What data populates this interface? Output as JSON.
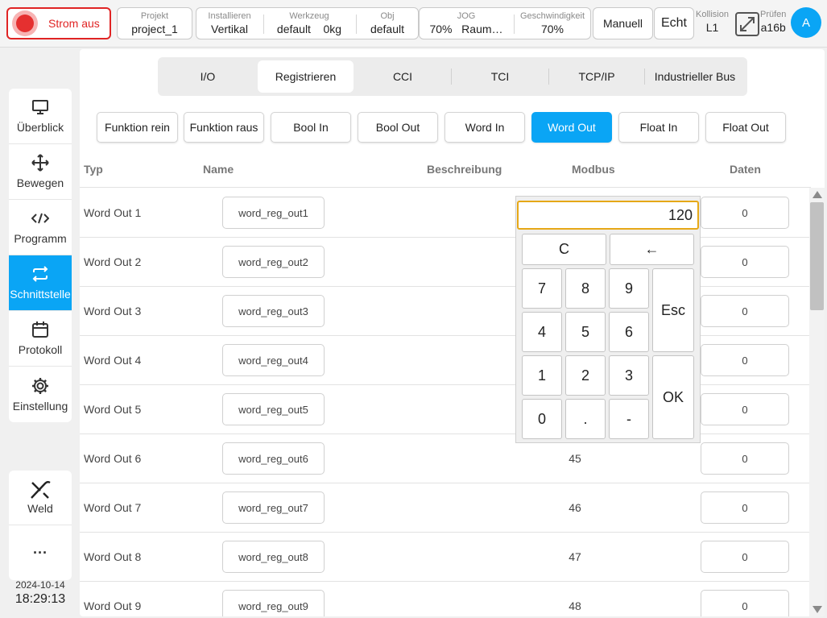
{
  "topbar": {
    "power_label": "Strom aus",
    "project": {
      "caption": "Projekt",
      "value": "project_1"
    },
    "install": {
      "caption": "Installieren",
      "value": "Vertikal"
    },
    "tool": {
      "caption": "Werkzeug",
      "name": "default",
      "weight": "0kg"
    },
    "obj": {
      "caption": "Obj",
      "value": "default"
    },
    "jog": {
      "caption": "JOG",
      "value": "70%",
      "frame": "Raum…"
    },
    "speed": {
      "caption": "Geschwindigkeit",
      "value": "70%"
    },
    "mode_label": "Manuell",
    "real_label": "Echt",
    "collision": {
      "caption": "Kollision",
      "value": "L1"
    },
    "check": {
      "caption": "Prüfen",
      "value": "a16b"
    },
    "avatar_letter": "A"
  },
  "sidebar": {
    "items": [
      {
        "label": "Überblick",
        "icon": "monitor-icon"
      },
      {
        "label": "Bewegen",
        "icon": "move-arrows-icon"
      },
      {
        "label": "Programm",
        "icon": "code-icon"
      },
      {
        "label": "Schnittstelle",
        "icon": "swap-arrows-icon",
        "active": true
      },
      {
        "label": "Protokoll",
        "icon": "calendar-icon"
      },
      {
        "label": "Einstellung",
        "icon": "gear-icon"
      }
    ],
    "weld_label": "Weld",
    "more_label": "···",
    "date": "2024-10-14",
    "time": "18:29:13"
  },
  "tabs": [
    "I/O",
    "Registrieren",
    "CCI",
    "TCI",
    "TCP/IP",
    "Industrieller Bus"
  ],
  "active_tab": "Registrieren",
  "subtabs": [
    "Funktion rein",
    "Funktion raus",
    "Bool In",
    "Bool Out",
    "Word In",
    "Word Out",
    "Float In",
    "Float Out"
  ],
  "active_subtab": "Word Out",
  "table": {
    "headers": {
      "typ": "Typ",
      "name": "Name",
      "desc": "Beschreibung",
      "modbus": "Modbus",
      "daten": "Daten"
    },
    "rows": [
      {
        "typ": "Word Out 1",
        "name": "word_reg_out1",
        "modbus": "",
        "daten": "0"
      },
      {
        "typ": "Word Out 2",
        "name": "word_reg_out2",
        "modbus": "",
        "daten": "0"
      },
      {
        "typ": "Word Out 3",
        "name": "word_reg_out3",
        "modbus": "",
        "daten": "0"
      },
      {
        "typ": "Word Out 4",
        "name": "word_reg_out4",
        "modbus": "",
        "daten": "0"
      },
      {
        "typ": "Word Out 5",
        "name": "word_reg_out5",
        "modbus": "",
        "daten": "0"
      },
      {
        "typ": "Word Out 6",
        "name": "word_reg_out6",
        "modbus": "45",
        "daten": "0"
      },
      {
        "typ": "Word Out 7",
        "name": "word_reg_out7",
        "modbus": "46",
        "daten": "0"
      },
      {
        "typ": "Word Out 8",
        "name": "word_reg_out8",
        "modbus": "47",
        "daten": "0"
      },
      {
        "typ": "Word Out 9",
        "name": "word_reg_out9",
        "modbus": "48",
        "daten": "0"
      }
    ]
  },
  "keypad": {
    "display": "120",
    "clear": "C",
    "backspace": "←",
    "esc": "Esc",
    "ok": "OK",
    "digits": [
      "7",
      "8",
      "9",
      "4",
      "5",
      "6",
      "1",
      "2",
      "3"
    ],
    "zero": "0",
    "dot": ".",
    "minus": "-"
  },
  "colors": {
    "accent": "#0aa5f5",
    "power": "#e02424",
    "keypad_focus": "#e6a817"
  }
}
